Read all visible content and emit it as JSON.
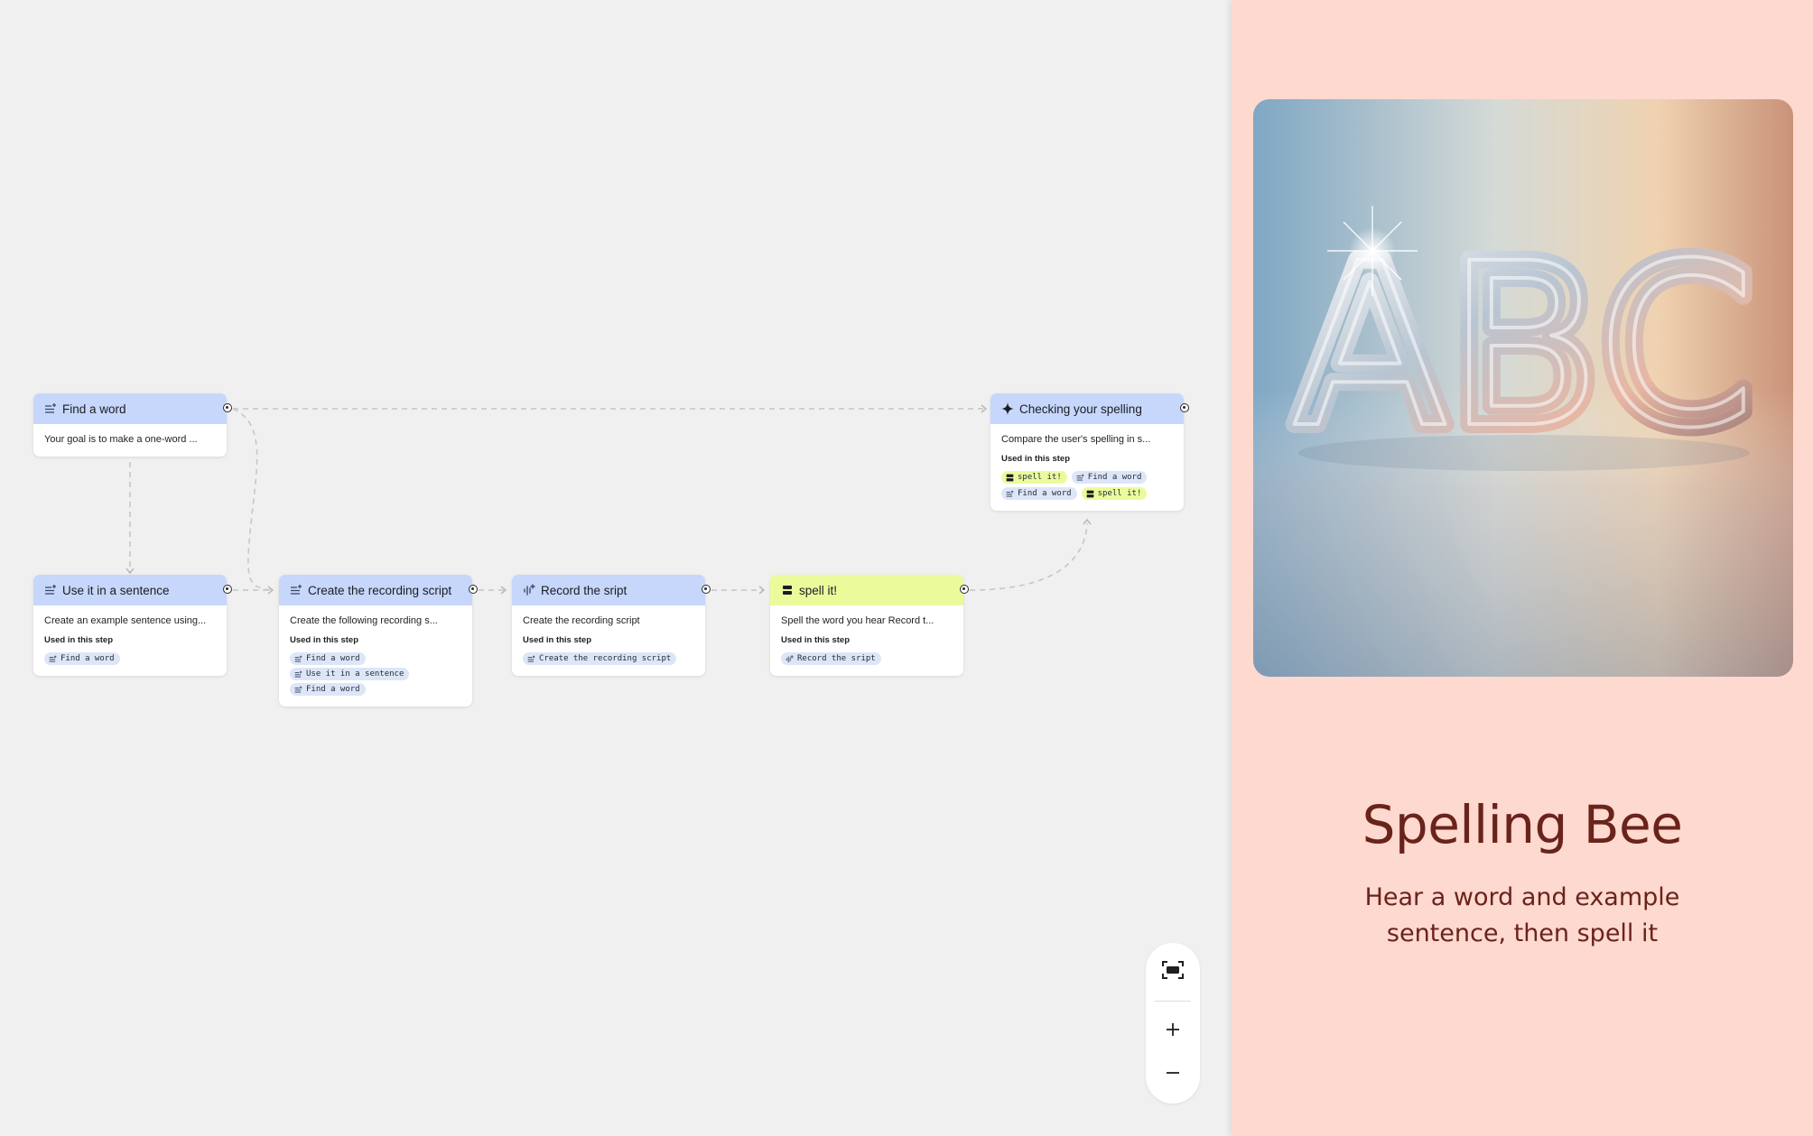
{
  "canvas": {
    "nodes": [
      {
        "id": "find-word",
        "title": "Find a word",
        "icon": "text-lines-icon",
        "description": "Your goal is to make a one-word ...",
        "used_label": "",
        "chips": []
      },
      {
        "id": "sentence",
        "title": "Use it in a sentence",
        "icon": "text-lines-icon",
        "description": "Create an example sentence using...",
        "used_label": "Used in this step",
        "chips": [
          {
            "label": "Find a word",
            "icon": "text-lines-icon"
          }
        ]
      },
      {
        "id": "script",
        "title": "Create the recording script",
        "icon": "text-lines-icon",
        "description": "Create the following recording s...",
        "used_label": "Used in this step",
        "chips": [
          {
            "label": "Find a word",
            "icon": "text-lines-icon"
          },
          {
            "label": "Use it in a sentence",
            "icon": "text-lines-icon"
          },
          {
            "label": "Find a word",
            "icon": "text-lines-icon"
          }
        ]
      },
      {
        "id": "record",
        "title": "Record the sript",
        "icon": "audio-wave-icon",
        "description": "Create the recording script",
        "used_label": "Used in this step",
        "chips": [
          {
            "label": "Create the recording script",
            "icon": "text-lines-icon"
          }
        ]
      },
      {
        "id": "spell",
        "title": "spell it!",
        "icon": "input-bars-icon",
        "description": "Spell the word you hear Record t...",
        "used_label": "Used in this step",
        "chips": [
          {
            "label": "Record the sript",
            "icon": "audio-wave-icon"
          }
        ]
      },
      {
        "id": "check",
        "title": "Checking your spelling",
        "icon": "sparkle-icon",
        "description": "Compare the user's spelling in s...",
        "used_label": "Used in this step",
        "chips": [
          {
            "label": "spell it!",
            "icon": "input-bars-icon",
            "highlight": true
          },
          {
            "label": "Find a word",
            "icon": "text-lines-icon"
          },
          {
            "label": "Find a word",
            "icon": "text-lines-icon"
          },
          {
            "label": "spell it!",
            "icon": "input-bars-icon",
            "highlight": true
          }
        ]
      }
    ],
    "colors": {
      "header_blue": "#c6d7fb",
      "header_yellow": "#ebfb9c",
      "chip_blue": "#dde6f7",
      "chip_yellow": "#ebfb9c",
      "edge": "#c4c4c4"
    }
  },
  "zoom_controls": {
    "fit_icon": "fit-view-icon",
    "zoom_in_icon": "plus-icon",
    "zoom_out_icon": "minus-icon"
  },
  "side_panel": {
    "image_text": "ABC",
    "title": "Spelling Bee",
    "subtitle": "Hear a word and example sentence, then spell it",
    "colors": {
      "background": "#fdd9cf",
      "text": "#6a231b"
    }
  }
}
